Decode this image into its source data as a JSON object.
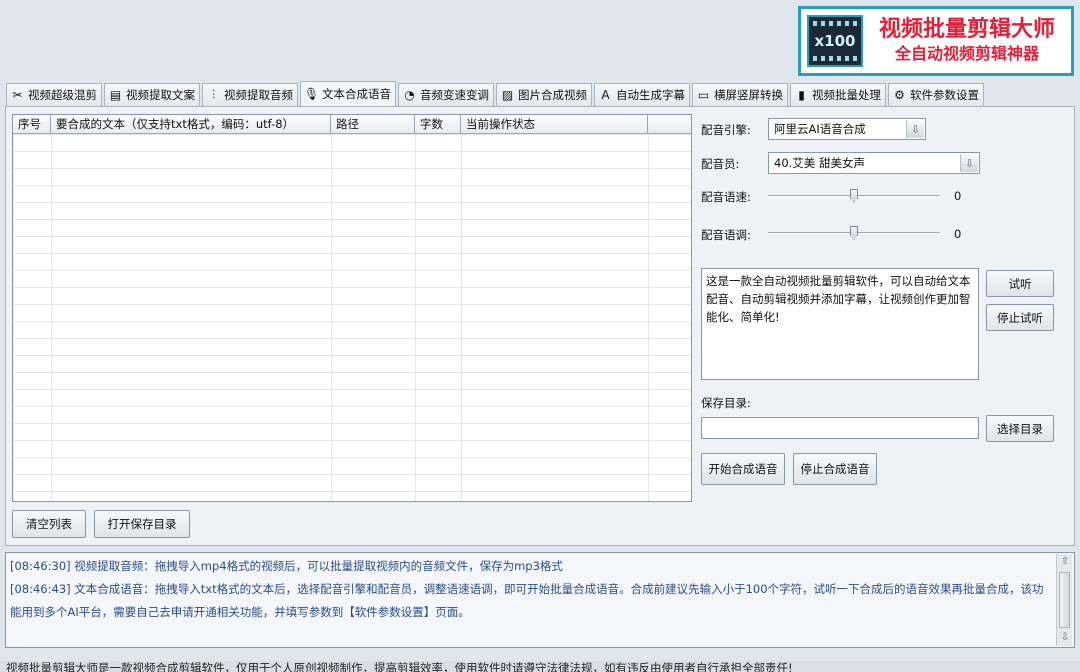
{
  "logo": {
    "badge": "x100",
    "title": "视频批量剪辑大师",
    "subtitle": "全自动视频剪辑神器"
  },
  "tabs": [
    {
      "icon": "scissors-icon",
      "glyph": "✂",
      "label": "视频超级混剪"
    },
    {
      "icon": "document-icon",
      "glyph": "▤",
      "label": "视频提取文案"
    },
    {
      "icon": "waveform-icon",
      "glyph": "⫶",
      "label": "视频提取音频"
    },
    {
      "icon": "microphone-icon",
      "glyph": "🎙",
      "label": "文本合成语音",
      "active": true
    },
    {
      "icon": "gauge-icon",
      "glyph": "◔",
      "label": "音频变速变调"
    },
    {
      "icon": "image-icon",
      "glyph": "▨",
      "label": "图片合成视频"
    },
    {
      "icon": "subtitle-icon",
      "glyph": "A",
      "label": "自动生成字幕"
    },
    {
      "icon": "rotate-screen-icon",
      "glyph": "▭",
      "label": "横屏竖屏转换"
    },
    {
      "icon": "film-icon",
      "glyph": "▮",
      "label": "视频批量处理"
    },
    {
      "icon": "gear-icon",
      "glyph": "⚙",
      "label": "软件参数设置"
    }
  ],
  "table": {
    "columns": [
      "序号",
      "要合成的文本（仅支持txt格式，编码：utf-8）",
      "路径",
      "字数",
      "当前操作状态"
    ],
    "rows": []
  },
  "buttons": {
    "clear_list": "清空列表",
    "open_save_dir": "打开保存目录",
    "listen": "试听",
    "stop_listen": "停止试听",
    "choose_dir": "选择目录",
    "start_synth": "开始合成语音",
    "stop_synth": "停止合成语音"
  },
  "settings": {
    "engine_label": "配音引擎:",
    "engine_value": "阿里云AI语音合成",
    "voice_label": "配音员:",
    "voice_value": "40.艾美 甜美女声",
    "speed_label": "配音语速:",
    "speed_value": "0",
    "pitch_label": "配音语调:",
    "pitch_value": "0",
    "sample_text": "这是一款全自动视频批量剪辑软件，可以自动给文本配音、自动剪辑视频并添加字幕，让视频创作更加智能化、简单化!",
    "save_dir_label": "保存目录:",
    "save_dir_value": ""
  },
  "log": [
    "[08:46:30] 视频提取音频：拖拽导入mp4格式的视频后，可以批量提取视频内的音频文件，保存为mp3格式",
    "[08:46:43] 文本合成语音：拖拽导入txt格式的文本后，选择配音引擎和配音员，调整语速语调，即可开始批量合成语音。合成前建议先输入小于100个字符，试听一下合成后的语音效果再批量合成，该功能用到多个AI平台，需要自己去申请开通相关功能，并填写参数到【软件参数设置】页面。"
  ],
  "status_text": "视频批量剪辑大师是一款视频合成剪辑软件，仅用于个人原创视频制作，提高剪辑效率，使用软件时请遵守法律法规，如有违反由使用者自行承担全部责任!"
}
